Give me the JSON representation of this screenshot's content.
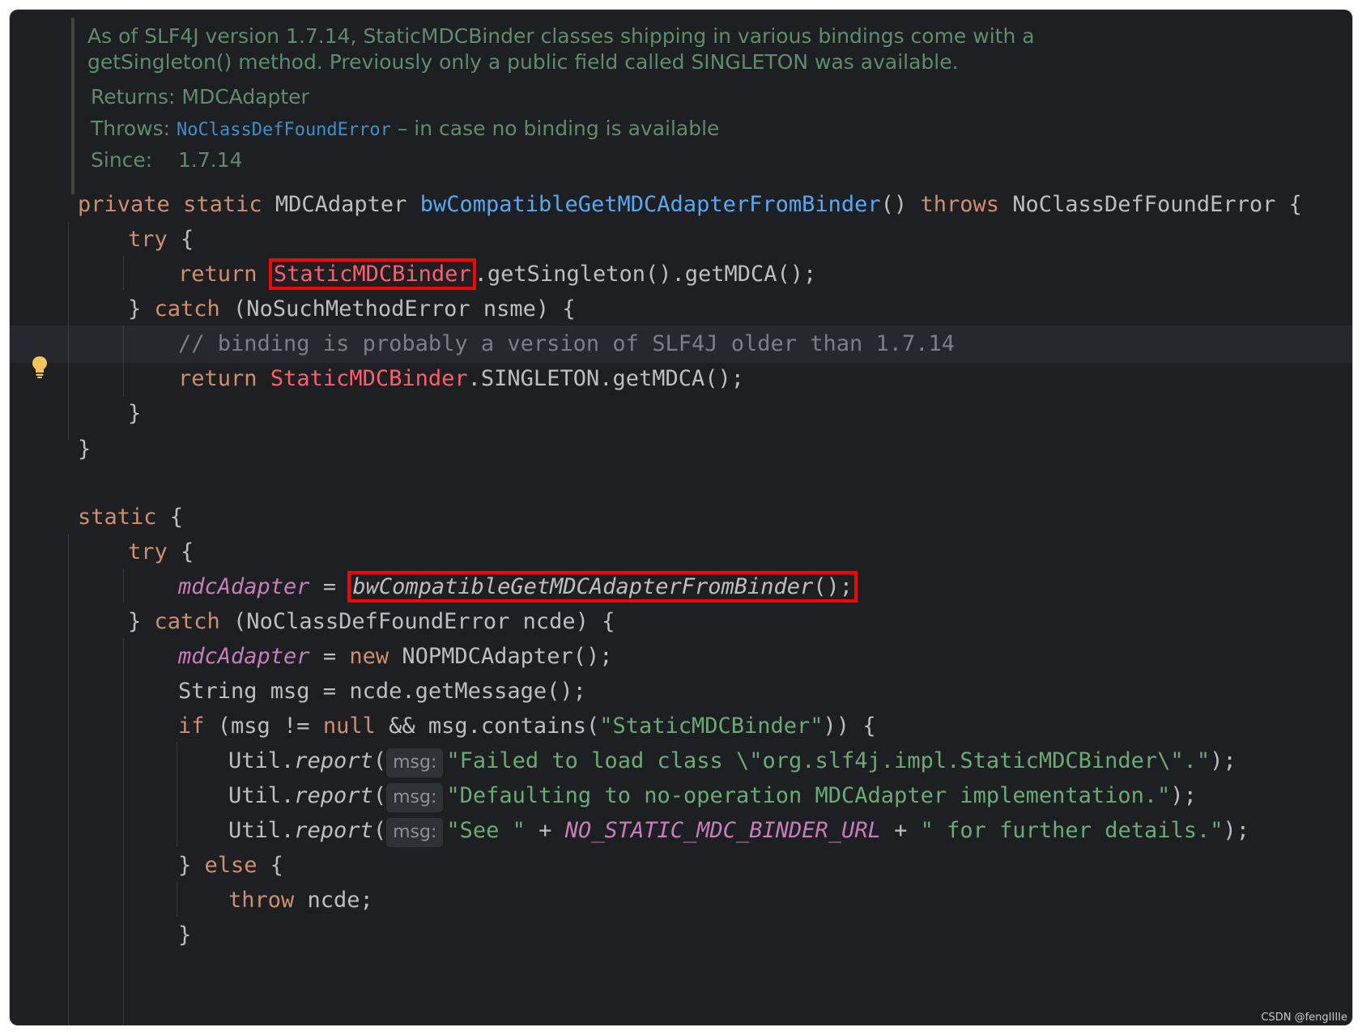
{
  "doc": {
    "line1": "As of SLF4J version 1.7.14, StaticMDCBinder classes shipping in various bindings come with a",
    "line2": "getSingleton() method. Previously only a public field called SINGLETON was available.",
    "returns_label": "Returns:",
    "returns_value": "MDCAdapter",
    "throws_label": "Throws:",
    "throws_link": "NoClassDefFoundError",
    "throws_desc": " – in case no binding is available",
    "since_label": "Since:",
    "since_value": "1.7.14"
  },
  "code": {
    "l1": {
      "kw1": "private",
      "kw2": "static",
      "type": "MDCAdapter",
      "method": "bwCompatibleGetMDCAdapterFromBinder",
      "rest1": "() ",
      "kw3": "throws",
      "rest2": " NoClassDefFoundError {"
    },
    "l2": {
      "kw": "try",
      "rest": " {"
    },
    "l3": {
      "kw": "return",
      "cls": "StaticMDCBinder",
      "rest": ".getSingleton().getMDCA();"
    },
    "l4": {
      "pre": "} ",
      "kw": "catch",
      "rest": " (NoSuchMethodError nsme) {"
    },
    "l5": {
      "comment": "// binding is probably a version of SLF4J older than 1.7.14"
    },
    "l6": {
      "kw": "return",
      "cls": "StaticMDCBinder",
      "rest": ".SINGLETON.getMDCA();"
    },
    "l7": "}",
    "l8": "}",
    "l9": {
      "kw": "static",
      "rest": " {"
    },
    "l10": {
      "kw": "try",
      "rest": " {"
    },
    "l11": {
      "field": "mdcAdapter",
      "op": " = ",
      "call": "bwCompatibleGetMDCAdapterFromBinder",
      "rest": "();"
    },
    "l12": {
      "pre": "} ",
      "kw": "catch",
      "rest": " (NoClassDefFoundError ncde) {"
    },
    "l13": {
      "field": "mdcAdapter",
      "op": " = ",
      "kw": "new",
      "rest": " NOPMDCAdapter();"
    },
    "l14": "String msg = ncde.getMessage();",
    "l15": {
      "kw": "if",
      "rest1": " (msg != ",
      "kw2": "null",
      "rest2": " && msg.contains(",
      "str": "\"StaticMDCBinder\"",
      "rest3": ")) {"
    },
    "l16": {
      "obj": "Util.",
      "method": "report",
      "paren": "(",
      "hint": "msg:",
      "str": "\"Failed to load class \\\"org.slf4j.impl.StaticMDCBinder\\\".\"",
      "rest": ");"
    },
    "l17": {
      "obj": "Util.",
      "method": "report",
      "paren": "(",
      "hint": "msg:",
      "str": "\"Defaulting to no-operation MDCAdapter implementation.\"",
      "rest": ");"
    },
    "l18": {
      "obj": "Util.",
      "method": "report",
      "paren": "(",
      "hint": "msg:",
      "str1": "\"See \"",
      "op1": " + ",
      "const": "NO_STATIC_MDC_BINDER_URL",
      "op2": " + ",
      "str2": "\" for further details.\"",
      "rest": ");"
    },
    "l19": {
      "pre": "} ",
      "kw": "else",
      "rest": " {"
    },
    "l20": {
      "kw": "throw",
      "rest": " ncde;"
    },
    "l21": "}"
  },
  "watermark": "CSDN @fengIIIIe",
  "icons": {
    "intention": "lightbulb-icon"
  },
  "colors": {
    "background": "#1e1f22",
    "keyword": "#cf8e6d",
    "method": "#56a8f5",
    "class_highlight": "#ff5e6c",
    "field": "#c77dbb",
    "string": "#6aab73",
    "comment": "#7a7e85",
    "doc_text": "#5f8c6a",
    "annotation_box": "#ff0000"
  }
}
